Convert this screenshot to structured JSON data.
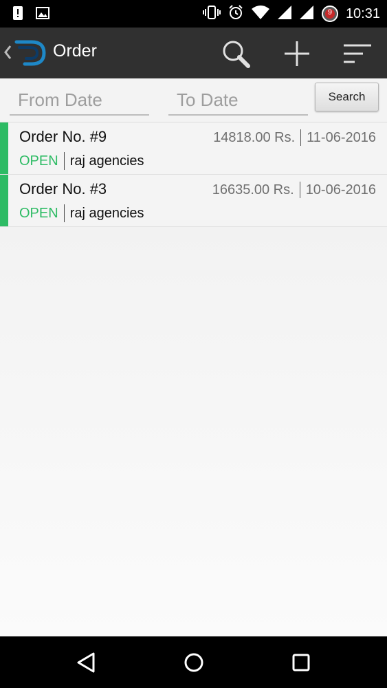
{
  "status_bar": {
    "time": "10:31",
    "notification_count": "9"
  },
  "app_bar": {
    "title": "Order"
  },
  "filter": {
    "from_placeholder": "From Date",
    "to_placeholder": "To Date",
    "search_label": "Search"
  },
  "orders": [
    {
      "order_no": "Order No. #9",
      "amount": "14818.00 Rs.",
      "date": "11-06-2016",
      "status": "OPEN",
      "party": "raj agencies"
    },
    {
      "order_no": "Order No. #3",
      "amount": "16635.00 Rs.",
      "date": "10-06-2016",
      "status": "OPEN",
      "party": "raj agencies"
    }
  ],
  "colors": {
    "accent_green": "#2dbb64",
    "app_bar": "#303030"
  }
}
